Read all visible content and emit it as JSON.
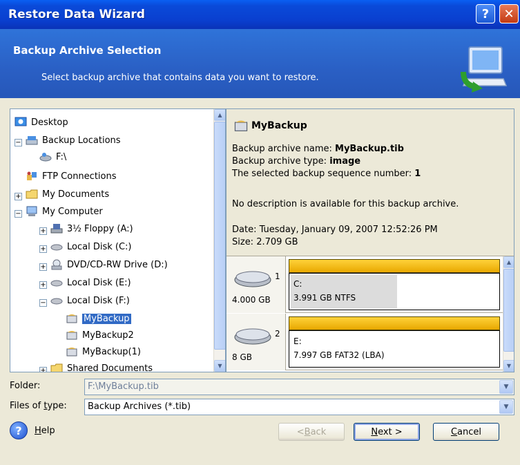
{
  "window": {
    "title": "Restore Data Wizard",
    "help_btn": "?",
    "close_btn": "✕"
  },
  "header": {
    "title": "Backup Archive Selection",
    "subtitle": "Select backup archive that contains data you want to restore."
  },
  "tree": {
    "items": [
      {
        "label": "Desktop",
        "icon": "desktop-icon"
      },
      {
        "label": "Backup Locations",
        "icon": "backup-locations-icon"
      },
      {
        "label": "F:\\",
        "icon": "backup-drive-icon"
      },
      {
        "label": "FTP Connections",
        "icon": "ftp-icon"
      },
      {
        "label": "My Documents",
        "icon": "folder-icon"
      },
      {
        "label": "My Computer",
        "icon": "computer-icon"
      },
      {
        "label": "3½ Floppy (A:)",
        "icon": "floppy-icon"
      },
      {
        "label": "Local Disk (C:)",
        "icon": "disk-icon"
      },
      {
        "label": "DVD/CD-RW Drive (D:)",
        "icon": "dvd-icon"
      },
      {
        "label": "Local Disk (E:)",
        "icon": "disk-icon"
      },
      {
        "label": "Local Disk (F:)",
        "icon": "disk-icon"
      },
      {
        "label": "MyBackup",
        "icon": "archive-icon"
      },
      {
        "label": "MyBackup2",
        "icon": "archive-icon"
      },
      {
        "label": "MyBackup(1)",
        "icon": "archive-icon"
      },
      {
        "label": "Shared Documents",
        "icon": "folder-icon"
      }
    ]
  },
  "info": {
    "name": "MyBackup",
    "archive_name_label": "Backup archive name: ",
    "archive_name": "MyBackup.tib",
    "archive_type_label": "Backup archive type: ",
    "archive_type": "image",
    "sequence_label": "The selected backup sequence number: ",
    "sequence": "1",
    "description": "No description is available for this backup archive.",
    "date": "Date: Tuesday, January 09, 2007 12:52:26 PM",
    "size": "Size: 2.709 GB",
    "disks": [
      {
        "num": "1",
        "size": "4.000 GB",
        "letter": "C:",
        "fs": "3.991 GB  NTFS"
      },
      {
        "num": "2",
        "size": "8 GB",
        "letter": "E:",
        "fs": "7.997 GB  FAT32 (LBA)"
      }
    ]
  },
  "fields": {
    "folder_label": "Folder:",
    "folder_value": "F:\\MyBackup.tib",
    "type_label_pre": "Files of ",
    "type_label_u": "t",
    "type_label_post": "ype:",
    "type_value": "Backup Archives (*.tib)"
  },
  "footer": {
    "help_u": "H",
    "help_rest": "elp",
    "back_pre": "< ",
    "back_u": "B",
    "back_rest": "ack",
    "next_u": "N",
    "next_rest": "ext >",
    "cancel_u": "C",
    "cancel_rest": "ancel"
  }
}
